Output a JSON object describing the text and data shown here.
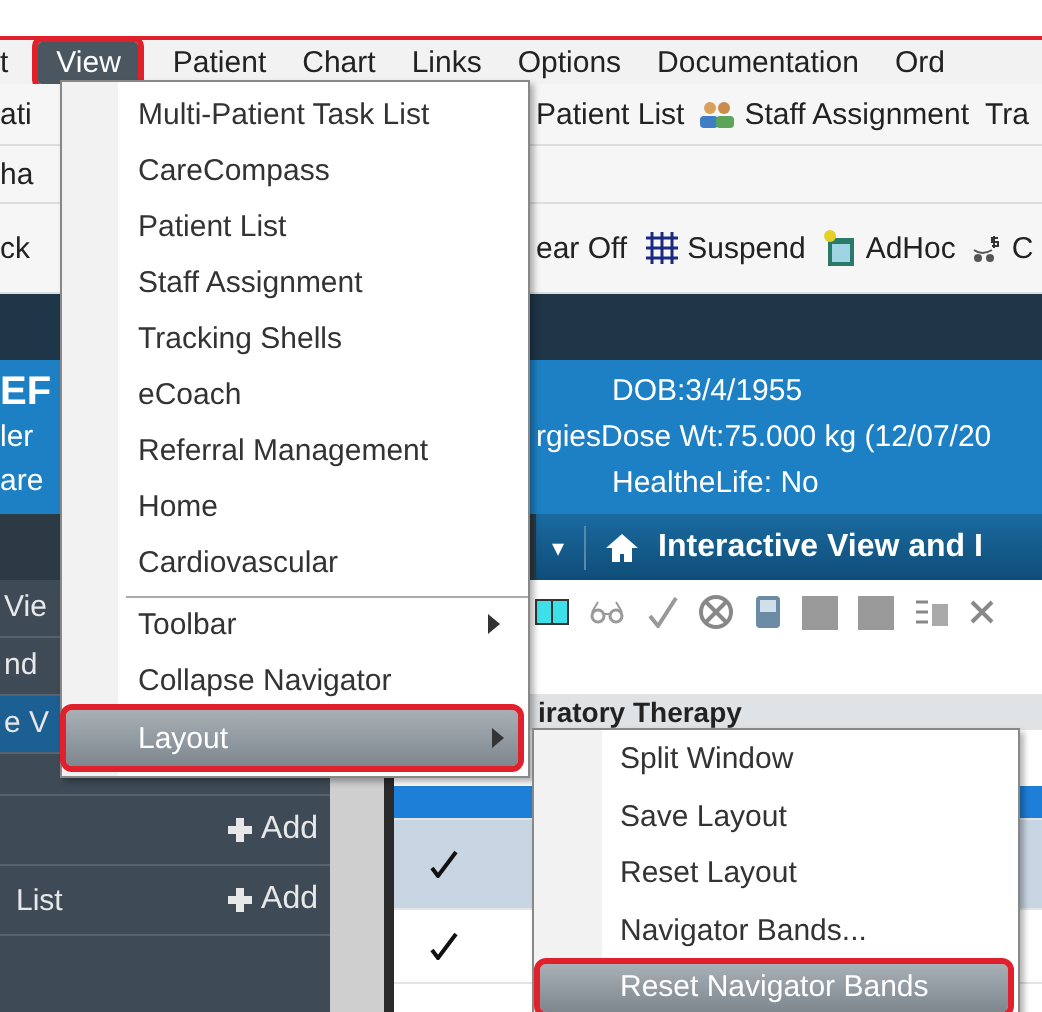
{
  "menubar": [
    {
      "label": "t",
      "selected": false
    },
    {
      "label": "View",
      "selected": true
    },
    {
      "label": "Patient",
      "selected": false
    },
    {
      "label": "Chart",
      "selected": false
    },
    {
      "label": "Links",
      "selected": false
    },
    {
      "label": "Options",
      "selected": false
    },
    {
      "label": "Documentation",
      "selected": false
    },
    {
      "label": "Ord",
      "selected": false
    }
  ],
  "toolbar_1": {
    "lead": "ati",
    "items": [
      "Patient List",
      "Staff Assignment",
      "Tra"
    ]
  },
  "toolbar_2": {
    "lead": "ha"
  },
  "toolbar_3": {
    "lead": "ck",
    "items": [
      "ear Off",
      "Suspend",
      "AdHoc",
      "C"
    ]
  },
  "banner": {
    "left": [
      "EF",
      "ler",
      "are"
    ],
    "dob": "DOB:3/4/1955",
    "allergies": "rgies",
    "dose": "Dose Wt:75.000 kg (12/07/20",
    "healthelife": "HealtheLife: No"
  },
  "band": {
    "caret": "▾",
    "title": "Interactive View and I"
  },
  "sidebar": {
    "items": [
      {
        "label": "Vie",
        "selected": false
      },
      {
        "label": "nd",
        "selected": false
      },
      {
        "label": "e V",
        "selected": true
      }
    ],
    "sections": [
      {
        "action": "Add"
      },
      {
        "label": "List",
        "action": "Add"
      }
    ]
  },
  "content": {
    "section": "iratory Therapy",
    "rows": [
      {
        "checked": false,
        "selected": true
      },
      {
        "checked": true,
        "selected": false
      },
      {
        "checked": true,
        "selected": false
      }
    ]
  },
  "view_menu": [
    {
      "label": "Multi-Patient Task List",
      "submenu": false,
      "separator_before": false,
      "selected": false
    },
    {
      "label": "CareCompass",
      "submenu": false,
      "separator_before": false,
      "selected": false
    },
    {
      "label": "Patient List",
      "submenu": false,
      "separator_before": false,
      "selected": false
    },
    {
      "label": "Staff Assignment",
      "submenu": false,
      "separator_before": false,
      "selected": false
    },
    {
      "label": "Tracking Shells",
      "submenu": false,
      "separator_before": false,
      "selected": false
    },
    {
      "label": "eCoach",
      "submenu": false,
      "separator_before": false,
      "selected": false
    },
    {
      "label": "Referral Management",
      "submenu": false,
      "separator_before": false,
      "selected": false
    },
    {
      "label": "Home",
      "submenu": false,
      "separator_before": false,
      "selected": false
    },
    {
      "label": "Cardiovascular",
      "submenu": false,
      "separator_before": false,
      "selected": false
    },
    {
      "label": "Toolbar",
      "submenu": true,
      "separator_before": true,
      "selected": false
    },
    {
      "label": "Collapse Navigator",
      "submenu": false,
      "separator_before": false,
      "selected": false
    },
    {
      "label": "Layout",
      "submenu": true,
      "separator_before": false,
      "selected": true
    }
  ],
  "layout_menu": [
    {
      "label": "Split Window",
      "selected": false
    },
    {
      "label": "Save Layout",
      "selected": false
    },
    {
      "label": "Reset Layout",
      "selected": false
    },
    {
      "label": "Navigator Bands...",
      "selected": false
    },
    {
      "label": "Reset Navigator Bands",
      "selected": true
    }
  ]
}
